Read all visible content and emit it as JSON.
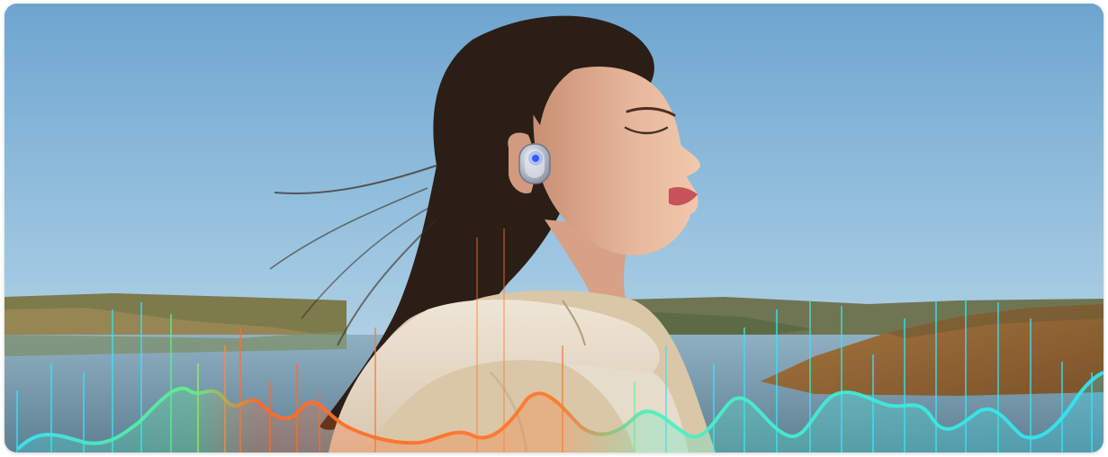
{
  "scene": {
    "description_tags": [
      "sky",
      "hills",
      "lake",
      "woman",
      "earbud",
      "sound-wave"
    ],
    "colors": {
      "sky_top": "#6fa6cf",
      "sky_bottom": "#c6dbe8",
      "water": "#6d8ea3",
      "hills": "#8a7a52",
      "cliff": "#9a6a38",
      "hair": "#2a1d17",
      "skin": "#e2b39a",
      "hoodie": "#e9ddcc",
      "earbud_body": "#c9cdd6",
      "earbud_light": "#2f5cff",
      "wave_cyan": "#33e6f2",
      "wave_warm": "#ff7a2a"
    }
  }
}
